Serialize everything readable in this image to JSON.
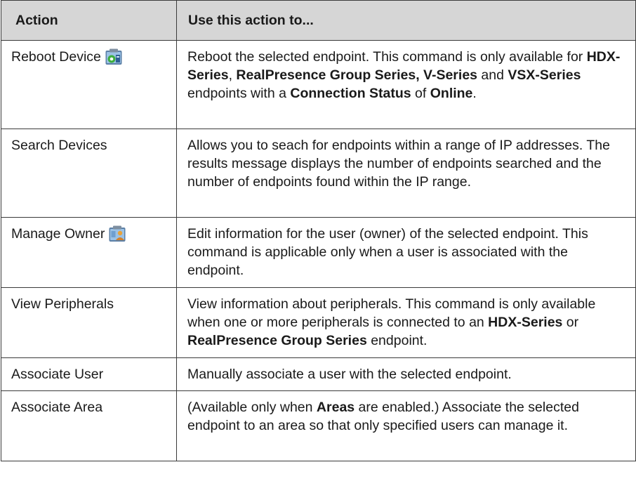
{
  "headers": {
    "action": "Action",
    "use": "Use this action to..."
  },
  "rows": [
    {
      "action": "Reboot Device",
      "icon": "reboot-device-icon",
      "desc": [
        {
          "t": "Reboot the selected endpoint. This command is only available for "
        },
        {
          "t": "HDX-Series",
          "b": true
        },
        {
          "t": ", "
        },
        {
          "t": "RealPresence Group Series, V-Series",
          "b": true
        },
        {
          "t": " and "
        },
        {
          "t": "VSX-Series",
          "b": true
        },
        {
          "t": " endpoints with a "
        },
        {
          "t": "Connection Status",
          "b": true
        },
        {
          "t": " of "
        },
        {
          "t": "Online",
          "b": true
        },
        {
          "t": "."
        }
      ]
    },
    {
      "action": "Search Devices",
      "desc": [
        {
          "t": "Allows you to seach for endpoints within a range of IP addresses. The results message displays the number of endpoints searched and the number of endpoints found within the IP range."
        }
      ]
    },
    {
      "action": "Manage Owner",
      "icon": "manage-owner-icon",
      "desc": [
        {
          "t": "Edit information for the user (owner) of the selected endpoint. This command is applicable only when a user is associated with the endpoint."
        }
      ]
    },
    {
      "action": "View Peripherals",
      "desc": [
        {
          "t": "View information about peripherals. This command is only available when one or more peripherals is connected to an "
        },
        {
          "t": "HDX-Series",
          "b": true
        },
        {
          "t": " or "
        },
        {
          "t": "RealPresence Group Series",
          "b": true
        },
        {
          "t": " endpoint."
        }
      ]
    },
    {
      "action": "Associate User",
      "desc": [
        {
          "t": "Manually associate a user with the selected endpoint."
        }
      ]
    },
    {
      "action": "Associate Area",
      "desc": [
        {
          "t": "(Available only when "
        },
        {
          "t": "Areas",
          "b": true
        },
        {
          "t": " are enabled.) Associate the selected endpoint to an area so that only specified users can manage it."
        }
      ]
    }
  ]
}
